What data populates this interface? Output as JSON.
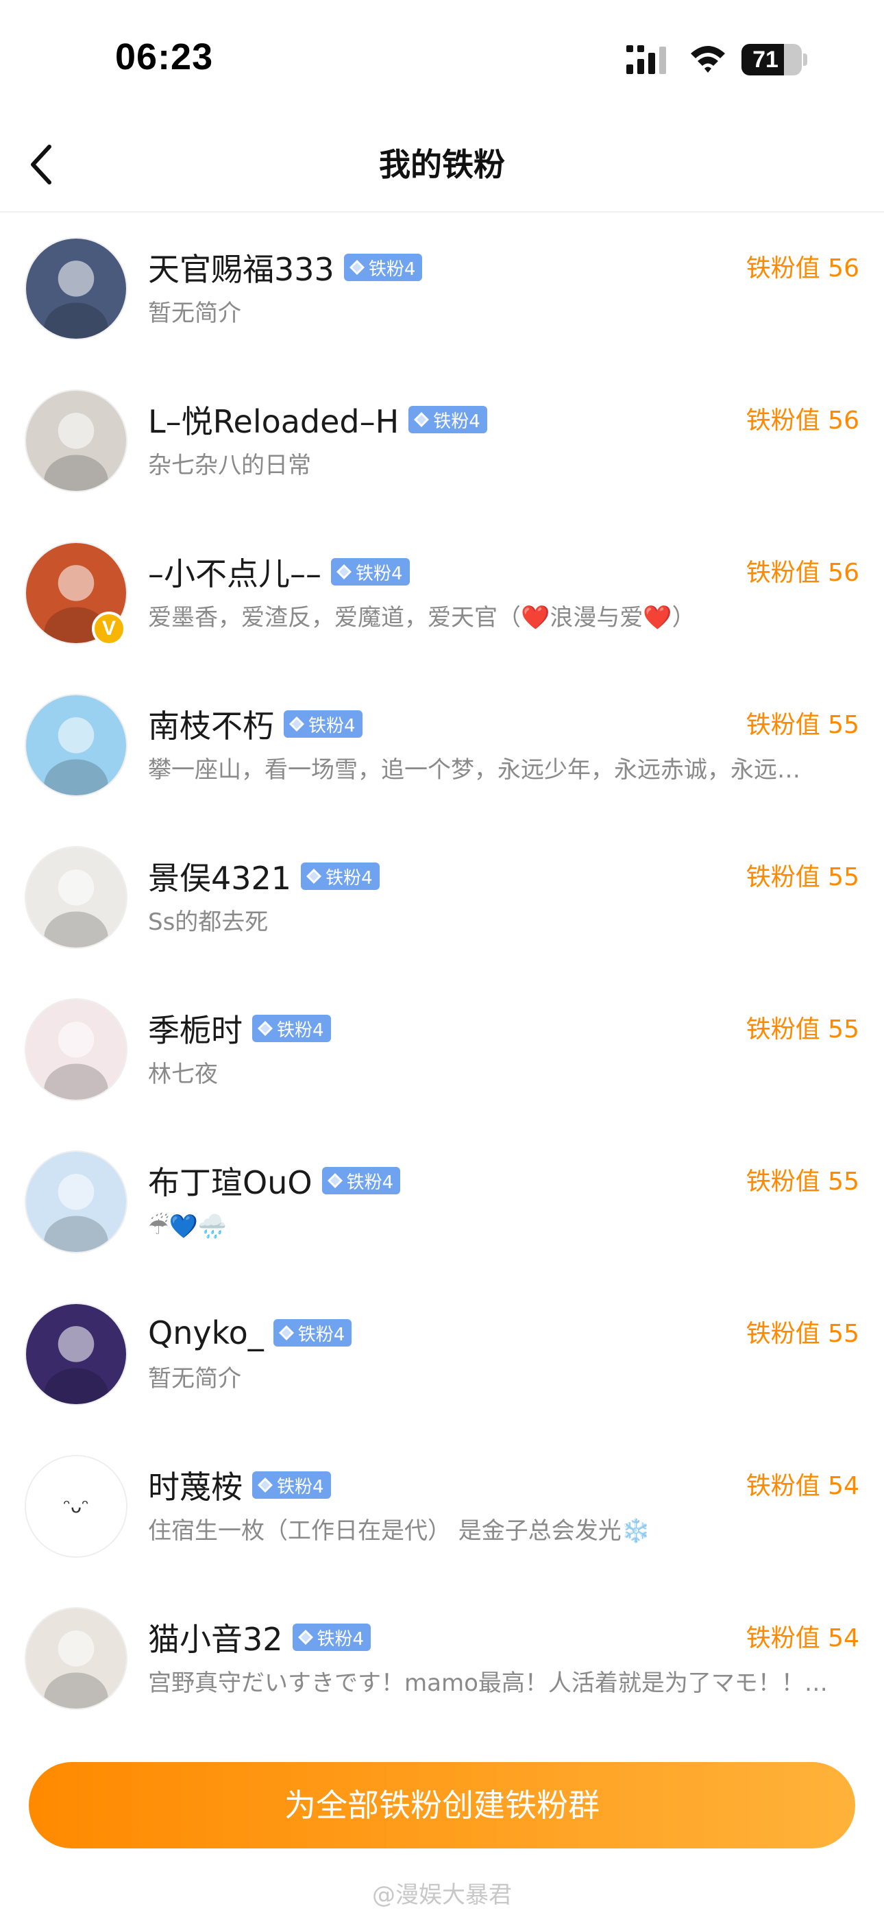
{
  "status_bar": {
    "time": "06:23",
    "battery": "71",
    "battery_level": 0.71
  },
  "nav": {
    "title": "我的铁粉"
  },
  "fans": [
    {
      "name": "天官赐福333",
      "badge": "铁粉4",
      "value": "铁粉值 56",
      "bio": "暂无简介",
      "verified": false,
      "avatar_color": "#4a5a7c"
    },
    {
      "name": "L–悦Reloaded–H",
      "badge": "铁粉4",
      "value": "铁粉值 56",
      "bio": "杂七杂八的日常",
      "verified": false,
      "avatar_color": "#d7d2cc"
    },
    {
      "name": "–小不点儿––",
      "badge": "铁粉4",
      "value": "铁粉值 56",
      "bio": "爱墨香，爱渣反，爱魔道，爱天官（❤️浪漫与爱❤️）",
      "verified": true,
      "verified_label": "V",
      "avatar_color": "#c9532b"
    },
    {
      "name": "南枝不朽",
      "badge": "铁粉4",
      "value": "铁粉值 55",
      "bio": "攀一座山，看一场雪，追一个梦，永远少年，永远赤诚，永远…",
      "verified": false,
      "avatar_color": "#9ad0f0"
    },
    {
      "name": "景俣4321",
      "badge": "铁粉4",
      "value": "铁粉值 55",
      "bio": "Ss的都去死",
      "verified": false,
      "avatar_color": "#eceae6"
    },
    {
      "name": "季栀时",
      "badge": "铁粉4",
      "value": "铁粉值 55",
      "bio": "林七夜",
      "verified": false,
      "avatar_color": "#f3e7ea"
    },
    {
      "name": "布丁瑄OuO",
      "badge": "铁粉4",
      "value": "铁粉值 55",
      "bio": "☔💙🌧️",
      "verified": false,
      "avatar_color": "#cfe3f4"
    },
    {
      "name": "Qnyko_",
      "badge": "铁粉4",
      "value": "铁粉值 55",
      "bio": "暂无简介",
      "verified": false,
      "avatar_color": "#3a2a6a"
    },
    {
      "name": "时蔑桉",
      "badge": "铁粉4",
      "value": "铁粉值 54",
      "bio": "住宿生一枚（工作日在是代） 是金子总会发光❄️",
      "verified": false,
      "avatar_color": "#ffffff",
      "avatar_text": "ᵔᴗᵔ"
    },
    {
      "name": "猫小音32",
      "badge": "铁粉4",
      "value": "铁粉值 54",
      "bio": "宫野真守だいすきです！mamo最高！人活着就是为了マモ！！…",
      "verified": false,
      "avatar_color": "#e9e4de"
    }
  ],
  "footer": {
    "button_label": "为全部铁粉创建铁粉群",
    "watermark": "@漫娱大暴君"
  },
  "colors": {
    "accent": "#ff8a00",
    "badge": "#6fa2ef"
  }
}
